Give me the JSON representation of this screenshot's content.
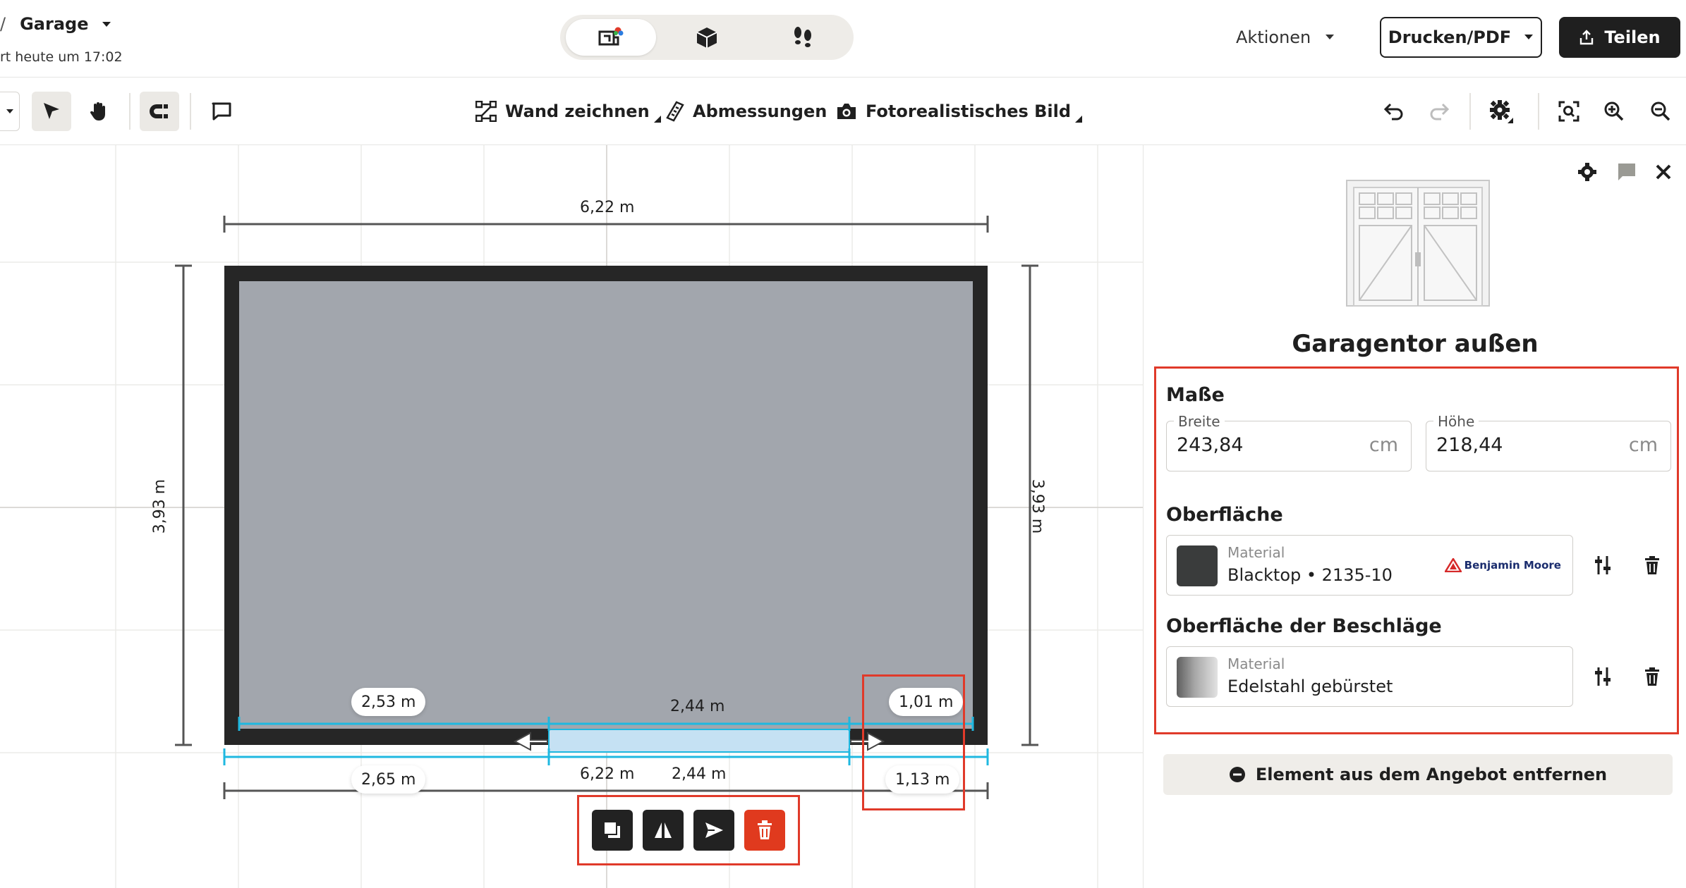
{
  "header": {
    "breadcrumb_sep": "/",
    "project_name": "Garage",
    "saved_text": "rt heute um 17:02",
    "actions_label": "Aktionen",
    "print_label": "Drucken/PDF",
    "share_label": "Teilen"
  },
  "view_toggle": [
    {
      "name": "2d-plan-icon",
      "active": true
    },
    {
      "name": "3d-box-icon",
      "active": false
    },
    {
      "name": "footsteps-icon",
      "active": false
    }
  ],
  "toolbar": {
    "draw_wall_label": "Wand zeichnen",
    "dimensions_label": "Abmessungen",
    "photo_label": "Fotorealistisches Bild"
  },
  "canvas": {
    "top_dim": "6,22 m",
    "left_dim": "3,93 m",
    "right_dim": "3,93 m",
    "bottom_total": "6,22 m",
    "door_width_bottom": "2,44 m",
    "door_width_top": "2,44 m",
    "left_inner": "2,53 m",
    "right_inner": "1,01 m",
    "left_outer": "2,65 m",
    "right_outer": "1,13 m"
  },
  "panel": {
    "title": "Garagentor außen",
    "dims_section": "Maße",
    "width_label": "Breite",
    "width_value": "243,84",
    "width_unit": "cm",
    "height_label": "Höhe",
    "height_value": "218,44",
    "height_unit": "cm",
    "surface_section": "Oberfläche",
    "surface_kicker": "Material",
    "surface_name": "Blacktop • 2135-10",
    "surface_brand": "Benjamin Moore",
    "surface_color": "#3a3c3c",
    "fittings_section": "Oberfläche der Beschläge",
    "fittings_kicker": "Material",
    "fittings_name": "Edelstahl gebürstet",
    "remove_label": "Element aus dem Angebot entfernen"
  },
  "colors": {
    "accent_highlight": "#e03a2a",
    "measure_line": "#1fb8e0",
    "selected_door": "#c5e1f3",
    "room_floor": "#a2a6ad",
    "wall": "#262626"
  }
}
